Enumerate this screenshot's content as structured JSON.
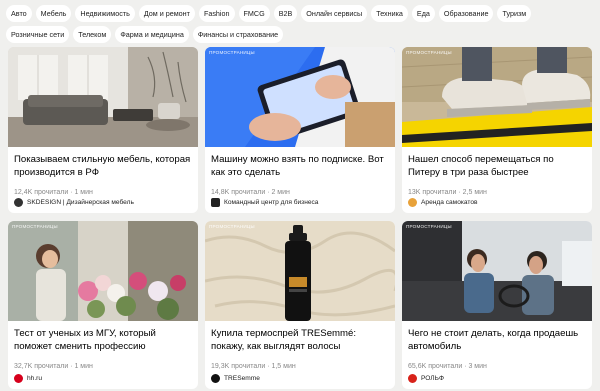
{
  "tags": [
    "Авто",
    "Мебель",
    "Недвижимость",
    "Дом и ремонт",
    "Fashion",
    "FMCG",
    "B2B",
    "Онлайн сервисы",
    "Техника",
    "Еда",
    "Образование",
    "Туризм",
    "Розничные сети",
    "Телеком",
    "Фарма и медицина",
    "Финансы и страхование"
  ],
  "cards": [
    {
      "badge": "",
      "title": "Показываем стильную мебель, которая производится в РФ",
      "reads": "12,4K прочитали",
      "time": "1 мин",
      "author": "SKDESIGN | Дизайнерская мебель",
      "avatar_color": "#333333",
      "avatar_icon": "skdesign-logo"
    },
    {
      "badge": "ПРОМОСТРАНИЦЫ",
      "title": "Машину можно взять по подписке. Вот как это сделать",
      "reads": "14,8K прочитали",
      "time": "2 мин",
      "author": "Командный центр для бизнеса",
      "avatar_color": "#222222",
      "avatar_icon": "business-center-logo"
    },
    {
      "badge": "ПРОМОСТРАНИЦЫ",
      "title": "Нашел способ перемещаться по Питеру в три раза быстрее",
      "reads": "13K прочитали",
      "time": "2,5 мин",
      "author": "Аренда самокатов",
      "avatar_color": "#e8a23a",
      "avatar_icon": "scooter-rental-logo"
    },
    {
      "badge": "ПРОМОСТРАНИЦЫ",
      "title": "Тест от ученых из МГУ, который поможет сменить профессию",
      "reads": "32,7K прочитали",
      "time": "1 мин",
      "author": "hh.ru",
      "avatar_color": "#d6001c",
      "avatar_icon": "hh-logo"
    },
    {
      "badge": "ПРОМОСТРАНИЦЫ",
      "title": "Купила термоспрей TRESemmé: покажу, как выглядят волосы",
      "reads": "19,3K прочитали",
      "time": "1,5 мин",
      "author": "TRESemme",
      "avatar_color": "#111111",
      "avatar_icon": "tresemme-logo"
    },
    {
      "badge": "ПРОМОСТРАНИЦЫ",
      "title": "Чего не стоит делать, когда продаешь автомобиль",
      "reads": "65,6K прочитали",
      "time": "3 мин",
      "author": "РОЛЬФ",
      "avatar_color": "#d8221a",
      "avatar_icon": "rolf-logo"
    }
  ],
  "dot": "·"
}
